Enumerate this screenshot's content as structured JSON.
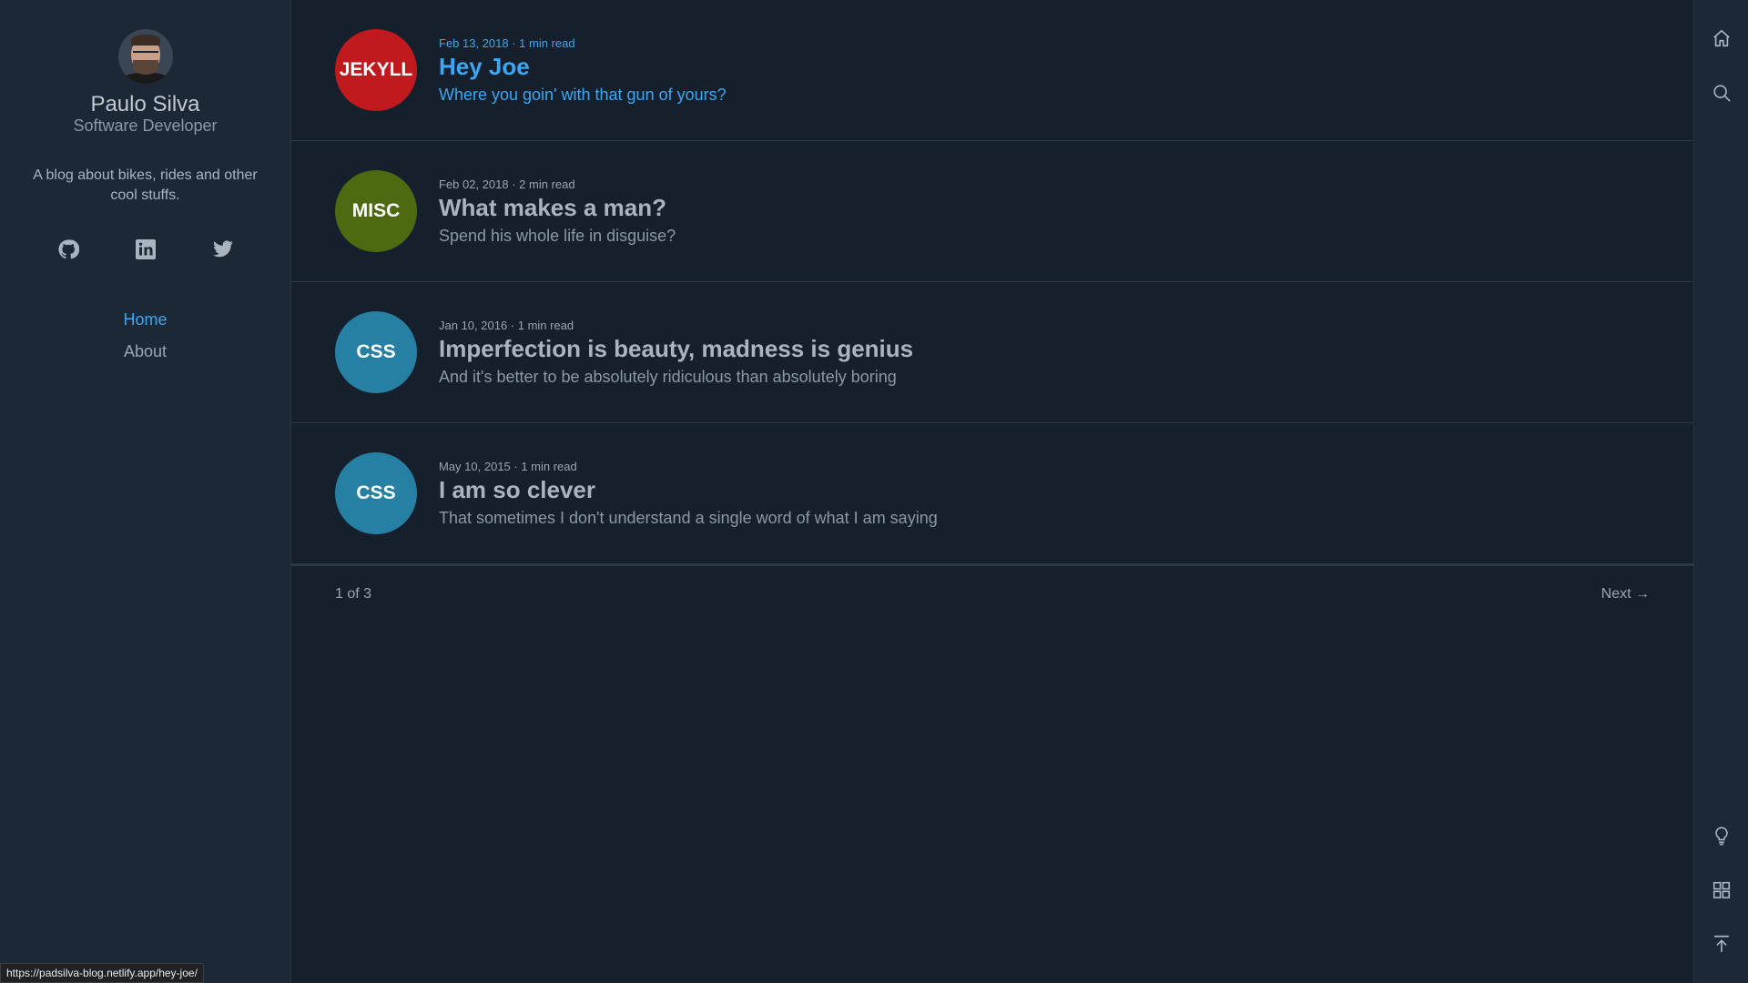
{
  "sidebar": {
    "author_name": "Paulo Silva",
    "author_role": "Software Developer",
    "tagline": "A blog about bikes, rides and other cool stuffs.",
    "socials": [
      "github-icon",
      "linkedin-icon",
      "twitter-icon"
    ],
    "nav": [
      {
        "label": "Home",
        "active": true
      },
      {
        "label": "About",
        "active": false
      }
    ]
  },
  "posts": [
    {
      "tag": "JEKYLL",
      "tag_color": "#c0191e",
      "meta": "Feb 13, 2018 · 1 min read",
      "title": "Hey Joe",
      "excerpt": "Where you goin' with that gun of yours?"
    },
    {
      "tag": "MISC",
      "tag_color": "#4d6a10",
      "meta": "Feb 02, 2018 · 2 min read",
      "title": "What makes a man?",
      "excerpt": "Spend his whole life in disguise?"
    },
    {
      "tag": "CSS",
      "tag_color": "#2680a4",
      "meta": "Jan 10, 2016 · 1 min read",
      "title": "Imperfection is beauty, madness is genius",
      "excerpt": "And it's better to be absolutely ridiculous than absolutely boring"
    },
    {
      "tag": "CSS",
      "tag_color": "#2680a4",
      "meta": "May 10, 2015 · 1 min read",
      "title": "I am so clever",
      "excerpt": "That sometimes I don't understand a single word of what I am saying"
    }
  ],
  "pagination": {
    "count": "1 of 3",
    "next": "Next →"
  },
  "rail": {
    "top": [
      "home-icon",
      "search-icon"
    ],
    "bottom": [
      "lightbulb-icon",
      "grid-icon",
      "scroll-top-icon"
    ]
  },
  "status_url": "https://padsilva-blog.netlify.app/hey-joe/",
  "colors": {
    "accent": "#3ea6f0",
    "background": "#16202c",
    "sidebar": "#1c2836"
  }
}
